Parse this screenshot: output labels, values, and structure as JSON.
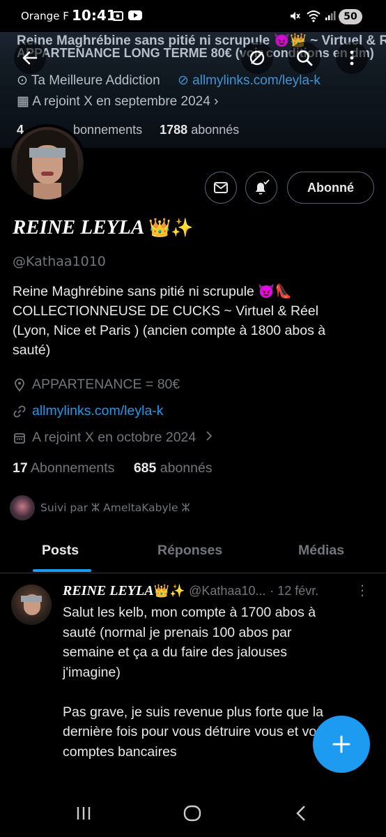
{
  "status_bar": {
    "carrier": "Orange F",
    "time": "10:41",
    "battery": "50"
  },
  "banner": {
    "line1": "Reine Maghrébine sans pitié ni scrupule 😈👑 ~ Virtuel & Réel",
    "line2": "APPARTENANCE LONG TERME 80€ (voir conditions en dm)",
    "location": "Ta Meilleure Addiction",
    "link": "allmylinks.com/leyla-k",
    "joined": "A rejoint X en septembre 2024",
    "following_partial": "4",
    "following_label": "bonnements",
    "followers_count": "1788",
    "followers_label": "abonnés"
  },
  "profile": {
    "display_name": "REINE LEYLA",
    "name_emoji": "👑✨",
    "handle": "@Kathaa1010",
    "bio_lines": [
      "Reine Maghrébine sans pitié ni scrupule 😈👠",
      "COLLECTIONNEUSE DE CUCKS ~ Virtuel & Réel",
      "(Lyon, Nice et Paris ) (ancien compte à 1800 abos à",
      "sauté)"
    ],
    "location": "APPARTENANCE = 80€",
    "website": "allmylinks.com/leyla-k",
    "joined": "A rejoint X en octobre 2024",
    "following_count": "17",
    "following_label": "Abonnements",
    "followers_count": "685",
    "followers_label": "abonnés",
    "followed_by": "Suivi par ⵣ AmeltaKabyle ⵣ",
    "follow_button": "Abonné"
  },
  "tabs": [
    {
      "label": "Posts",
      "active": true
    },
    {
      "label": "Réponses",
      "active": false
    },
    {
      "label": "Médias",
      "active": false
    }
  ],
  "post": {
    "author": "REINE LEYLA",
    "author_emoji": "👑✨",
    "handle": "@Kathaa10...",
    "date": "· 12 févr.",
    "lines": [
      "Salut les kelb, mon compte à 1700 abos à",
      "sauté (normal je prenais 100 abos par",
      "semaine et ça a du faire des jalouses",
      "j'imagine)",
      "",
      "Pas grave, je suis revenue plus forte que la",
      "dernière fois pour vous détruire vous et vos",
      "comptes bancaires"
    ]
  },
  "icons": {
    "back": "arrow-left-icon",
    "search": "search-icon",
    "message": "envelope-icon",
    "notify": "bell-check-icon",
    "compose": "plus-icon"
  },
  "colors": {
    "accent": "#1d9bf0",
    "muted": "#71767b",
    "text": "#e7e9ea"
  }
}
